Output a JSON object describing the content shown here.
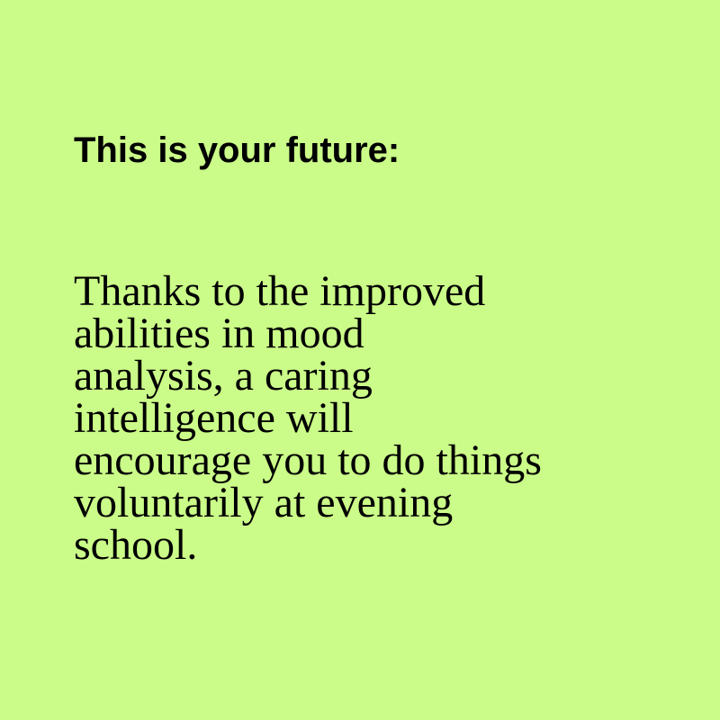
{
  "heading": "This is your future:",
  "body_lines": [
    "Thanks to the improved",
    "abilities in mood",
    "analysis, a caring",
    "intelligence will",
    "encourage you to do things",
    "voluntarily at evening",
    "school."
  ],
  "colors": {
    "background": "#cbfb88",
    "text": "#000000"
  }
}
